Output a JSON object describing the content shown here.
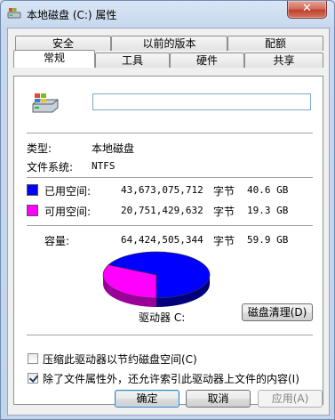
{
  "window": {
    "title": "本地磁盘 (C:) 属性",
    "close_label": "✕"
  },
  "tabs_row1": [
    "安全",
    "以前的版本",
    "配额"
  ],
  "tabs_row2": [
    "常规",
    "工具",
    "硬件",
    "共享"
  ],
  "general": {
    "name_value": "",
    "type_label": "类型:",
    "type_value": "本地磁盘",
    "fs_label": "文件系统:",
    "fs_value": "NTFS",
    "used": {
      "label": "已用空间:",
      "bytes": "43,673,075,712",
      "unit": "字节",
      "human": "40.6 GB",
      "color": "#0000ff"
    },
    "free": {
      "label": "可用空间:",
      "bytes": "20,751,429,632",
      "unit": "字节",
      "human": "19.3 GB",
      "color": "#ff00ff"
    },
    "capacity": {
      "label": "容量:",
      "bytes": "64,424,505,344",
      "unit": "字节",
      "human": "59.9 GB"
    },
    "used_fraction": 0.678,
    "drive_label": "驱动器 C:",
    "cleanup_button": "磁盘清理(D)",
    "compress_label": "压缩此驱动器以节约磁盘空间(C)",
    "compress_checked": false,
    "index_label": "除了文件属性外，还允许索引此驱动器上文件的内容(I)",
    "index_checked": true
  },
  "buttons": {
    "ok": "确定",
    "cancel": "取消",
    "apply": "应用(A)"
  }
}
